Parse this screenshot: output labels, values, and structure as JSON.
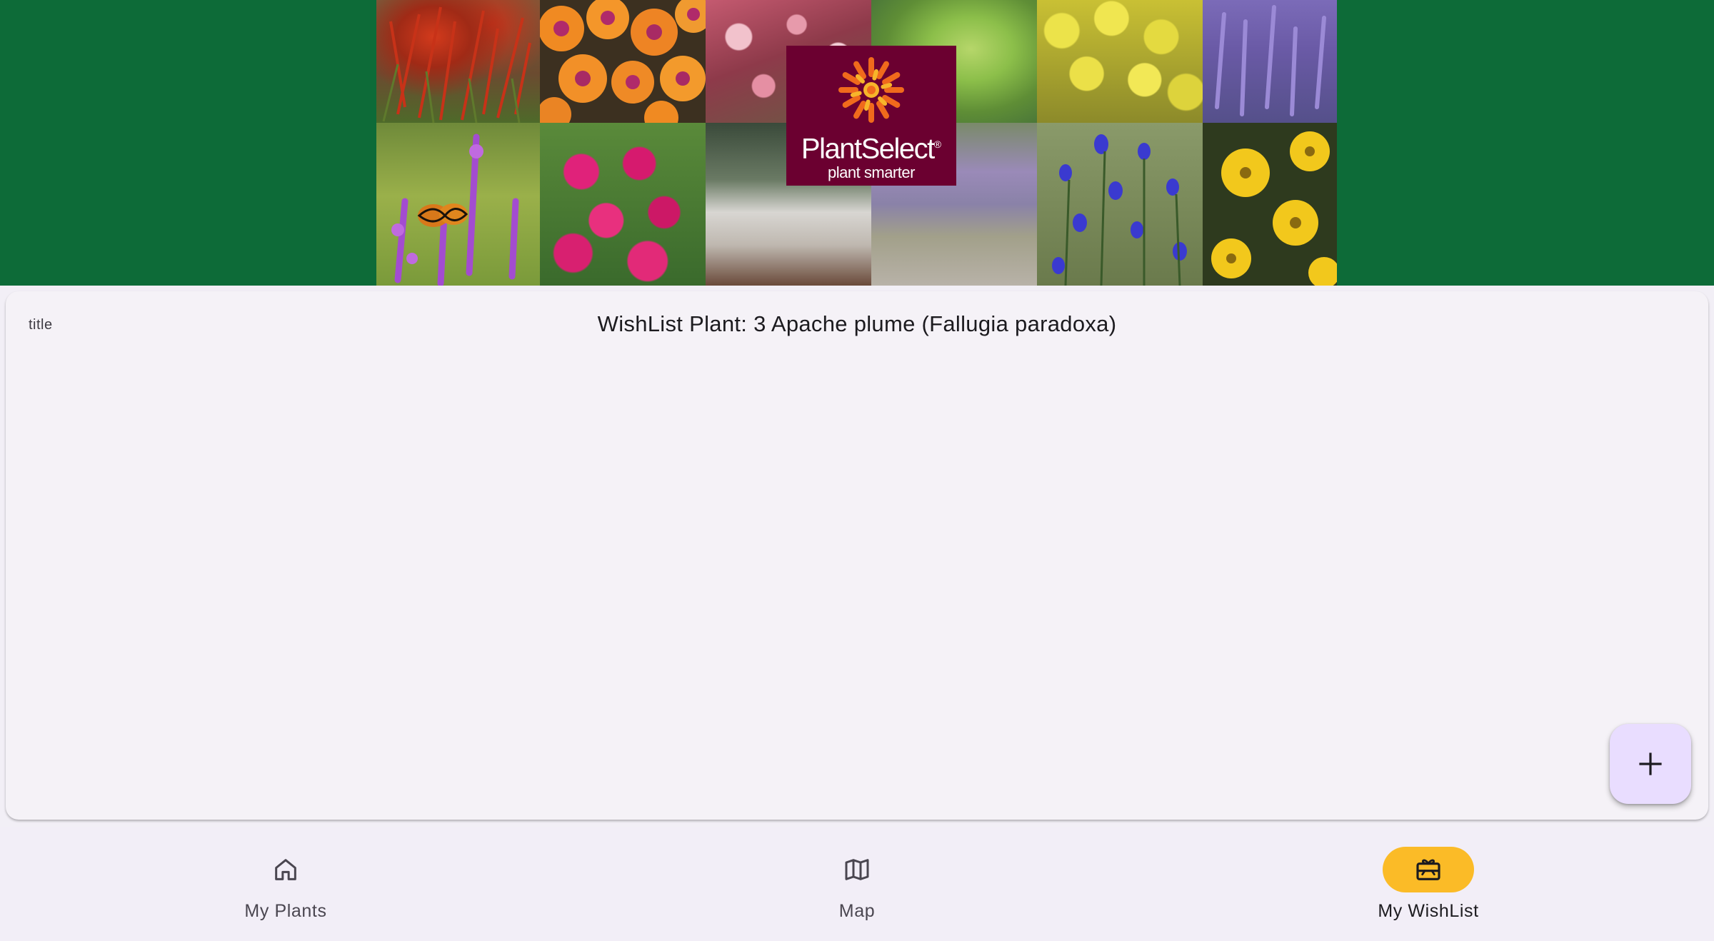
{
  "banner": {
    "logo_brand": "PlantSelect",
    "logo_registered": "®",
    "logo_tagline": "plant smarter",
    "colors": {
      "background": "#0d6b38",
      "logo_box": "#6b0030",
      "sun_outer": "#f06a1c",
      "sun_inner": "#f7b52a"
    }
  },
  "card": {
    "field_label": "title",
    "title": "WishList Plant: 3 Apache plume (Fallugia paradoxa)"
  },
  "fab": {
    "icon": "plus-icon",
    "color": "#e9ddff"
  },
  "bottom_nav": {
    "active_color": "#fbbb27",
    "items": [
      {
        "label": "My Plants",
        "icon": "home-icon",
        "active": false
      },
      {
        "label": "Map",
        "icon": "map-icon",
        "active": false
      },
      {
        "label": "My WishList",
        "icon": "gift-card-icon",
        "active": true
      }
    ]
  }
}
